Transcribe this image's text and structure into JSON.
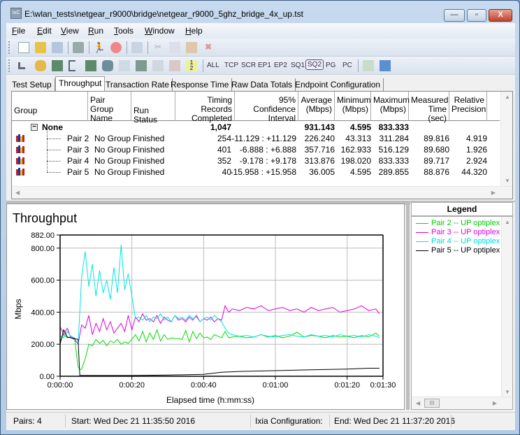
{
  "window": {
    "title": "E:\\wlan_tests\\netgear_r9000\\bridge\\netgear_r9000_5ghz_bridge_4x_up.tst",
    "minimize_label": "—",
    "maximize_label": "▫",
    "close_label": "X"
  },
  "menu": [
    {
      "label": "File",
      "accel": "F",
      "rest": "ile"
    },
    {
      "label": "Edit",
      "accel": "E",
      "rest": "dit"
    },
    {
      "label": "View",
      "accel": "V",
      "rest": "iew"
    },
    {
      "label": "Run",
      "accel": "R",
      "rest": "un"
    },
    {
      "label": "Tools",
      "accel": "T",
      "rest": "ools"
    },
    {
      "label": "Window",
      "accel": "W",
      "rest": "indow"
    },
    {
      "label": "Help",
      "accel": "H",
      "rest": "elp"
    }
  ],
  "toolbar1": [
    "new-file-icon",
    "open-folder-icon",
    "save-icon",
    "print-icon",
    "run-icon",
    "stop-icon",
    "refresh-icon",
    "cut-icon",
    "copy-icon",
    "paste-icon",
    "delete-icon"
  ],
  "toolbar2": {
    "icons": [
      "pair-icon",
      "multicast-icon",
      "endpoint-icon",
      "network-icon",
      "monitor-icon",
      "broadcast-icon",
      "edit-icon",
      "script-icon",
      "script-disabled-icon",
      "compare-icon",
      "number-icon"
    ],
    "filters": [
      "ALL",
      "TCP",
      "SCR",
      "EP1",
      "EP2",
      "SQ1",
      "SQ2",
      "PG",
      "PC"
    ],
    "selected_filter": "SQ2",
    "trailing_icons": [
      "export-icon",
      "import-icon"
    ]
  },
  "tabs": [
    {
      "label": "Test Setup",
      "active": false
    },
    {
      "label": "Throughput",
      "active": true
    },
    {
      "label": "Transaction Rate",
      "active": false
    },
    {
      "label": "Response Time",
      "active": false
    },
    {
      "label": "Raw Data Totals",
      "active": false
    },
    {
      "label": "Endpoint Configuration",
      "active": false
    }
  ],
  "table": {
    "columns": [
      {
        "l1": "",
        "l2": "Group"
      },
      {
        "l1": "Pair Group",
        "l2": "Name"
      },
      {
        "l1": "",
        "l2": "Run Status"
      },
      {
        "l1": "Timing Records",
        "l2": "Completed"
      },
      {
        "l1": "95% Confidence",
        "l2": "Interval"
      },
      {
        "l1": "Average",
        "l2": "(Mbps)"
      },
      {
        "l1": "Minimum",
        "l2": "(Mbps)"
      },
      {
        "l1": "Maximum",
        "l2": "(Mbps)"
      },
      {
        "l1": "Measured",
        "l2": "Time (sec)"
      },
      {
        "l1": "Relative",
        "l2": "Precision"
      }
    ],
    "group_row": {
      "group": "None",
      "records": "1,047",
      "average": "931.143",
      "minimum": "4.595",
      "maximum": "833.333"
    },
    "rows": [
      {
        "pair": "Pair 2",
        "group_name": "No Group",
        "status": "Finished",
        "records": "254",
        "ci": "-11.129 : +11.129",
        "average": "226.240",
        "minimum": "43.313",
        "maximum": "311.284",
        "time": "89.816",
        "precision": "4.919"
      },
      {
        "pair": "Pair 3",
        "group_name": "No Group",
        "status": "Finished",
        "records": "401",
        "ci": "-6.888 : +6.888",
        "average": "357.716",
        "minimum": "162.933",
        "maximum": "516.129",
        "time": "89.680",
        "precision": "1.926"
      },
      {
        "pair": "Pair 4",
        "group_name": "No Group",
        "status": "Finished",
        "records": "352",
        "ci": "-9.178 : +9.178",
        "average": "313.876",
        "minimum": "198.020",
        "maximum": "833.333",
        "time": "89.717",
        "precision": "2.924"
      },
      {
        "pair": "Pair 5",
        "group_name": "No Group",
        "status": "Finished",
        "records": "40",
        "ci": "-15.958 : +15.958",
        "average": "36.005",
        "minimum": "4.595",
        "maximum": "289.855",
        "time": "88.876",
        "precision": "44.320"
      }
    ]
  },
  "legend": {
    "title": "Legend",
    "items": [
      {
        "label": "Pair 2 -- UP optiplex",
        "color": "#00dd00"
      },
      {
        "label": "Pair 3 -- UP optiplex",
        "color": "#dd00dd"
      },
      {
        "label": "Pair 4 -- UP optiplex",
        "color": "#00e5e5"
      },
      {
        "label": "Pair 5 -- UP optiplex",
        "color": "#000000"
      }
    ],
    "scroll_thumb": "III"
  },
  "status": {
    "pairs": "Pairs: 4",
    "start": "Start: Wed Dec 21 11:35:50 2016",
    "ixia": "Ixia Configuration:",
    "end": "End: Wed Dec 21 11:37:20 2016"
  },
  "chart_data": {
    "type": "line",
    "title": "Throughput",
    "xlabel": "Elapsed time (h:mm:ss)",
    "ylabel": "Mbps",
    "xlim": [
      0,
      90
    ],
    "ylim": [
      0,
      882
    ],
    "x_ticks": [
      {
        "v": 0,
        "label": "0:00:00"
      },
      {
        "v": 20,
        "label": "0:00:20"
      },
      {
        "v": 40,
        "label": "0:00:40"
      },
      {
        "v": 60,
        "label": "0:01:00"
      },
      {
        "v": 80,
        "label": "0:01:20"
      },
      {
        "v": 90,
        "label": "0:01:30"
      }
    ],
    "y_ticks": [
      {
        "v": 0,
        "label": "0.00"
      },
      {
        "v": 200,
        "label": "200.00"
      },
      {
        "v": 400,
        "label": "400.00"
      },
      {
        "v": 600,
        "label": "600.00"
      },
      {
        "v": 800,
        "label": "800.00"
      },
      {
        "v": 882,
        "label": "882.00"
      }
    ],
    "grid": true,
    "series": [
      {
        "name": "Pair 2 -- UP optiplex",
        "color": "#00dd00",
        "x": [
          0,
          1,
          2,
          3,
          4,
          5,
          5.5,
          6,
          7,
          8,
          9,
          10,
          11,
          12,
          13,
          14,
          15,
          16,
          17,
          18,
          19,
          20,
          21,
          22,
          23,
          24,
          25,
          26,
          27,
          28,
          29,
          30,
          31,
          32,
          33,
          34,
          35,
          36,
          37,
          38,
          39,
          40,
          41,
          42,
          43,
          44,
          45,
          46,
          47,
          48,
          50,
          52,
          54,
          56,
          58,
          60,
          62,
          64,
          66,
          68,
          70,
          72,
          74,
          76,
          78,
          80,
          82,
          84,
          86,
          88,
          89
        ],
        "y": [
          220,
          260,
          240,
          245,
          240,
          60,
          40,
          45,
          110,
          200,
          190,
          230,
          205,
          225,
          190,
          220,
          210,
          230,
          200,
          215,
          205,
          230,
          260,
          220,
          280,
          215,
          270,
          230,
          290,
          220,
          260,
          230,
          240,
          235,
          235,
          230,
          285,
          215,
          280,
          235,
          270,
          240,
          245,
          230,
          260,
          250,
          240,
          280,
          240,
          245,
          250,
          240,
          245,
          260,
          245,
          255,
          240,
          250,
          275,
          245,
          255,
          250,
          240,
          255,
          245,
          250,
          240,
          255,
          245,
          270,
          250
        ]
      },
      {
        "name": "Pair 3 -- UP optiplex",
        "color": "#dd00dd",
        "x": [
          0,
          1,
          2,
          3,
          4,
          5,
          6,
          7,
          8,
          9,
          10,
          11,
          12,
          13,
          14,
          15,
          16,
          17,
          18,
          19,
          20,
          21,
          22,
          23,
          24,
          25,
          26,
          27,
          28,
          29,
          30,
          31,
          32,
          33,
          34,
          35,
          36,
          37,
          38,
          39,
          40,
          41,
          42,
          43,
          44,
          45,
          46,
          47,
          48,
          50,
          52,
          54,
          56,
          58,
          60,
          62,
          64,
          66,
          68,
          70,
          72,
          74,
          76,
          78,
          80,
          82,
          84,
          86,
          88,
          89
        ],
        "y": [
          310,
          260,
          300,
          240,
          230,
          200,
          320,
          300,
          380,
          260,
          330,
          280,
          360,
          290,
          340,
          270,
          300,
          330,
          280,
          380,
          290,
          370,
          340,
          390,
          350,
          360,
          340,
          380,
          330,
          370,
          350,
          340,
          380,
          350,
          360,
          340,
          370,
          350,
          380,
          340,
          360,
          350,
          370,
          340,
          360,
          350,
          440,
          400,
          420,
          410,
          430,
          420,
          440,
          410,
          420,
          430,
          410,
          420,
          400,
          430,
          410,
          420,
          430,
          400,
          410,
          420,
          440,
          410,
          420,
          390
        ]
      },
      {
        "name": "Pair 4 -- UP optiplex",
        "color": "#00e5e5",
        "x": [
          0,
          1,
          2,
          3,
          4,
          5,
          6,
          7,
          8,
          9,
          10,
          11,
          12,
          13,
          14,
          15,
          16,
          17,
          18,
          19,
          20,
          21,
          22,
          23,
          24,
          25,
          26,
          27,
          28,
          29,
          30,
          31,
          32,
          33,
          34,
          35,
          36,
          37,
          38,
          39,
          40,
          41,
          42,
          43,
          44,
          45,
          46,
          47,
          48,
          50,
          52,
          54,
          56,
          58,
          60,
          62,
          64,
          66,
          68,
          70,
          72,
          74,
          76,
          78,
          80,
          82,
          84,
          86,
          88,
          89
        ],
        "y": [
          250,
          240,
          280,
          250,
          240,
          200,
          620,
          780,
          560,
          700,
          500,
          660,
          520,
          600,
          480,
          680,
          520,
          820,
          540,
          640,
          500,
          360,
          370,
          350,
          380,
          340,
          370,
          360,
          390,
          350,
          370,
          340,
          380,
          360,
          370,
          350,
          380,
          360,
          370,
          340,
          360,
          370,
          350,
          380,
          360,
          340,
          300,
          270,
          260,
          250,
          255,
          245,
          260,
          250,
          245,
          255,
          260,
          250,
          245,
          260,
          250,
          255,
          245,
          260,
          250,
          255,
          245,
          260,
          250,
          240
        ]
      },
      {
        "name": "Pair 5 -- UP optiplex",
        "color": "#000000",
        "x": [
          0,
          1,
          2,
          3,
          4,
          5,
          5.5,
          10,
          20,
          30,
          40,
          45,
          50,
          60,
          70,
          80,
          86,
          89
        ],
        "y": [
          200,
          290,
          245,
          240,
          235,
          230,
          5,
          5,
          5,
          8,
          12,
          25,
          30,
          35,
          40,
          45,
          50,
          50
        ]
      }
    ],
    "legend_position": "right"
  }
}
